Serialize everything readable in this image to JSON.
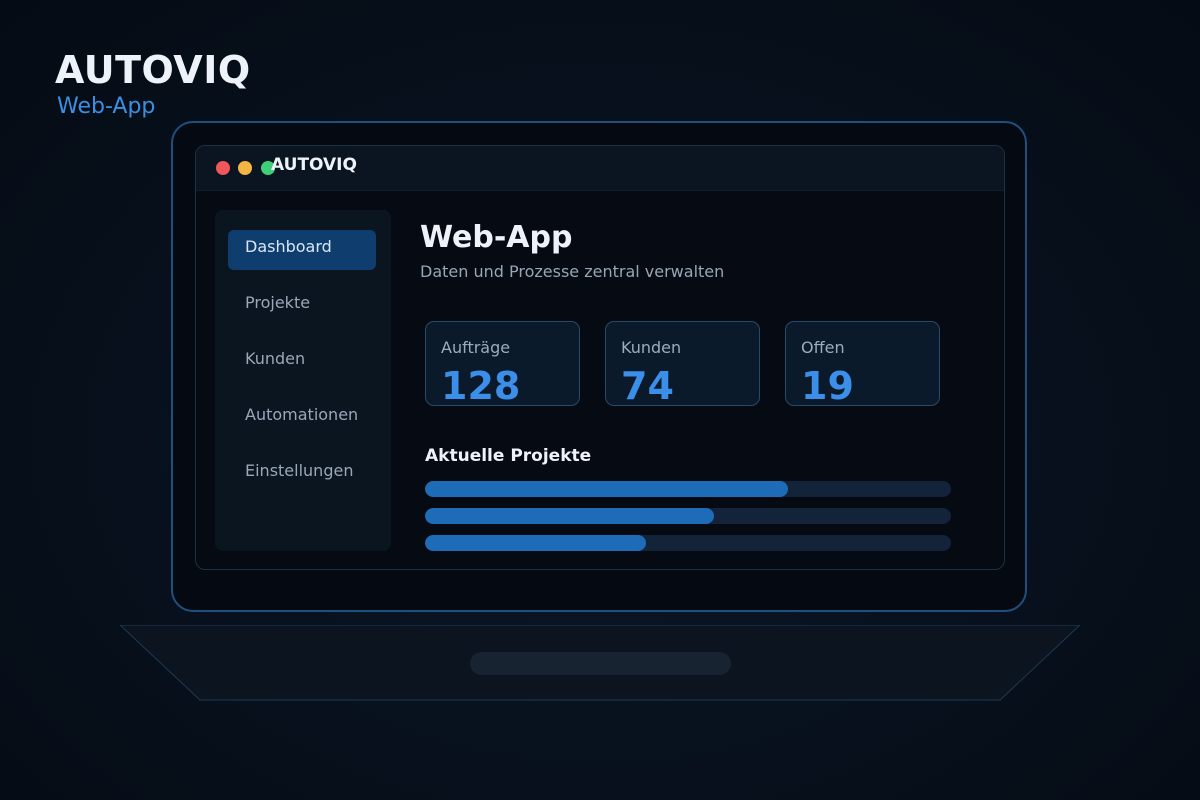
{
  "brand": {
    "title": "AUTOVIQ",
    "subtitle": "Web-App"
  },
  "window": {
    "title": "AUTOVIQ"
  },
  "sidebar": {
    "items": [
      {
        "label": "Dashboard",
        "active": true
      },
      {
        "label": "Projekte",
        "active": false
      },
      {
        "label": "Kunden",
        "active": false
      },
      {
        "label": "Automationen",
        "active": false
      },
      {
        "label": "Einstellungen",
        "active": false
      }
    ]
  },
  "main": {
    "title": "Web-App",
    "subtitle": "Daten und Prozesse zentral verwalten",
    "stats": [
      {
        "label": "Aufträge",
        "value": "128"
      },
      {
        "label": "Kunden",
        "value": "74"
      },
      {
        "label": "Offen",
        "value": "19"
      }
    ],
    "projects": {
      "title": "Aktuelle Projekte",
      "progress": [
        0.69,
        0.55,
        0.42
      ]
    }
  },
  "colors": {
    "accent": "#3b8fe3",
    "progress_fill": "#1e6bb8",
    "progress_track": "#13233a",
    "active_nav": "#0f3e6e",
    "dot_red": "#f0565a",
    "dot_yellow": "#f5b544",
    "dot_green": "#3fcf78"
  }
}
